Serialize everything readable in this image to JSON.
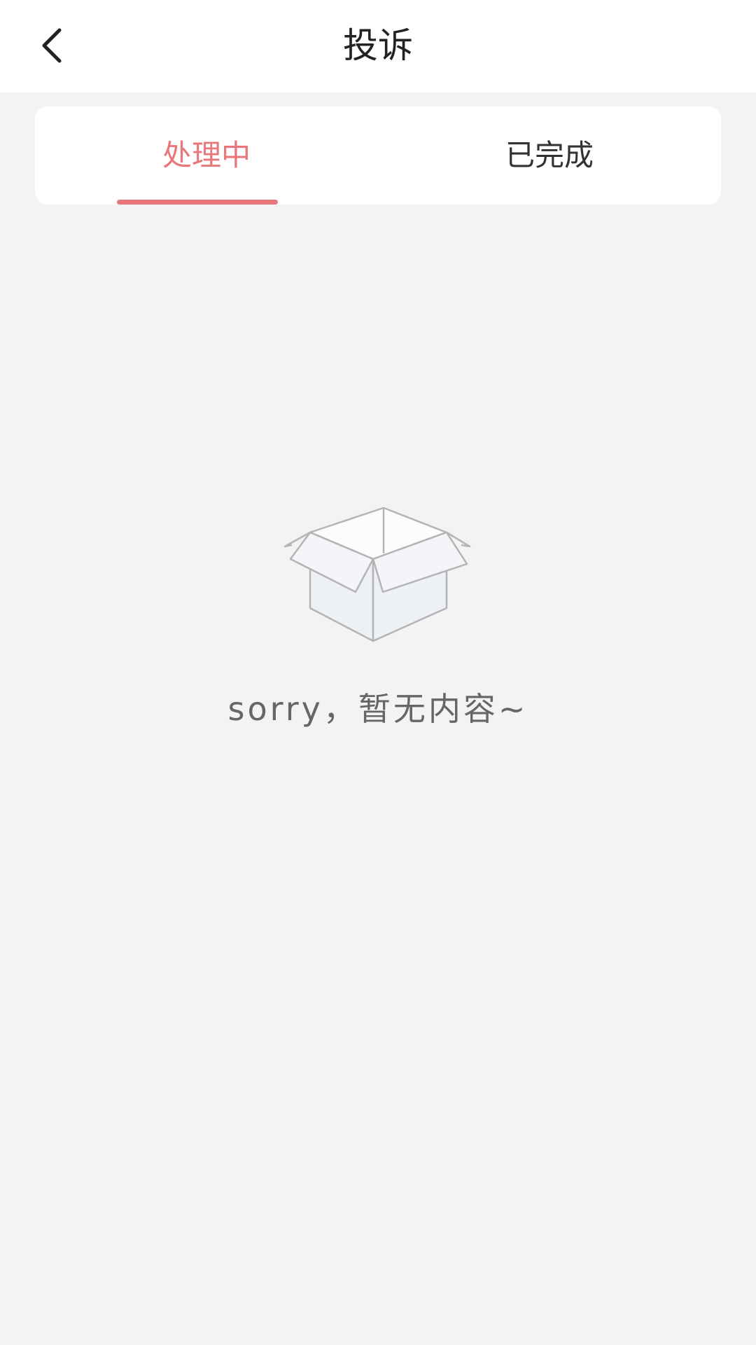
{
  "header": {
    "title": "投诉",
    "back_icon": "chevron-left-icon"
  },
  "tabs": [
    {
      "label": "处理中",
      "active": true
    },
    {
      "label": "已完成",
      "active": false
    }
  ],
  "colors": {
    "accent": "#e8777b",
    "background": "#f4f2f3",
    "card": "#ffffff",
    "text_primary": "#222222",
    "text_secondary": "#666666"
  },
  "empty_state": {
    "icon": "empty-box-icon",
    "message": "sorry，暂无内容~"
  }
}
